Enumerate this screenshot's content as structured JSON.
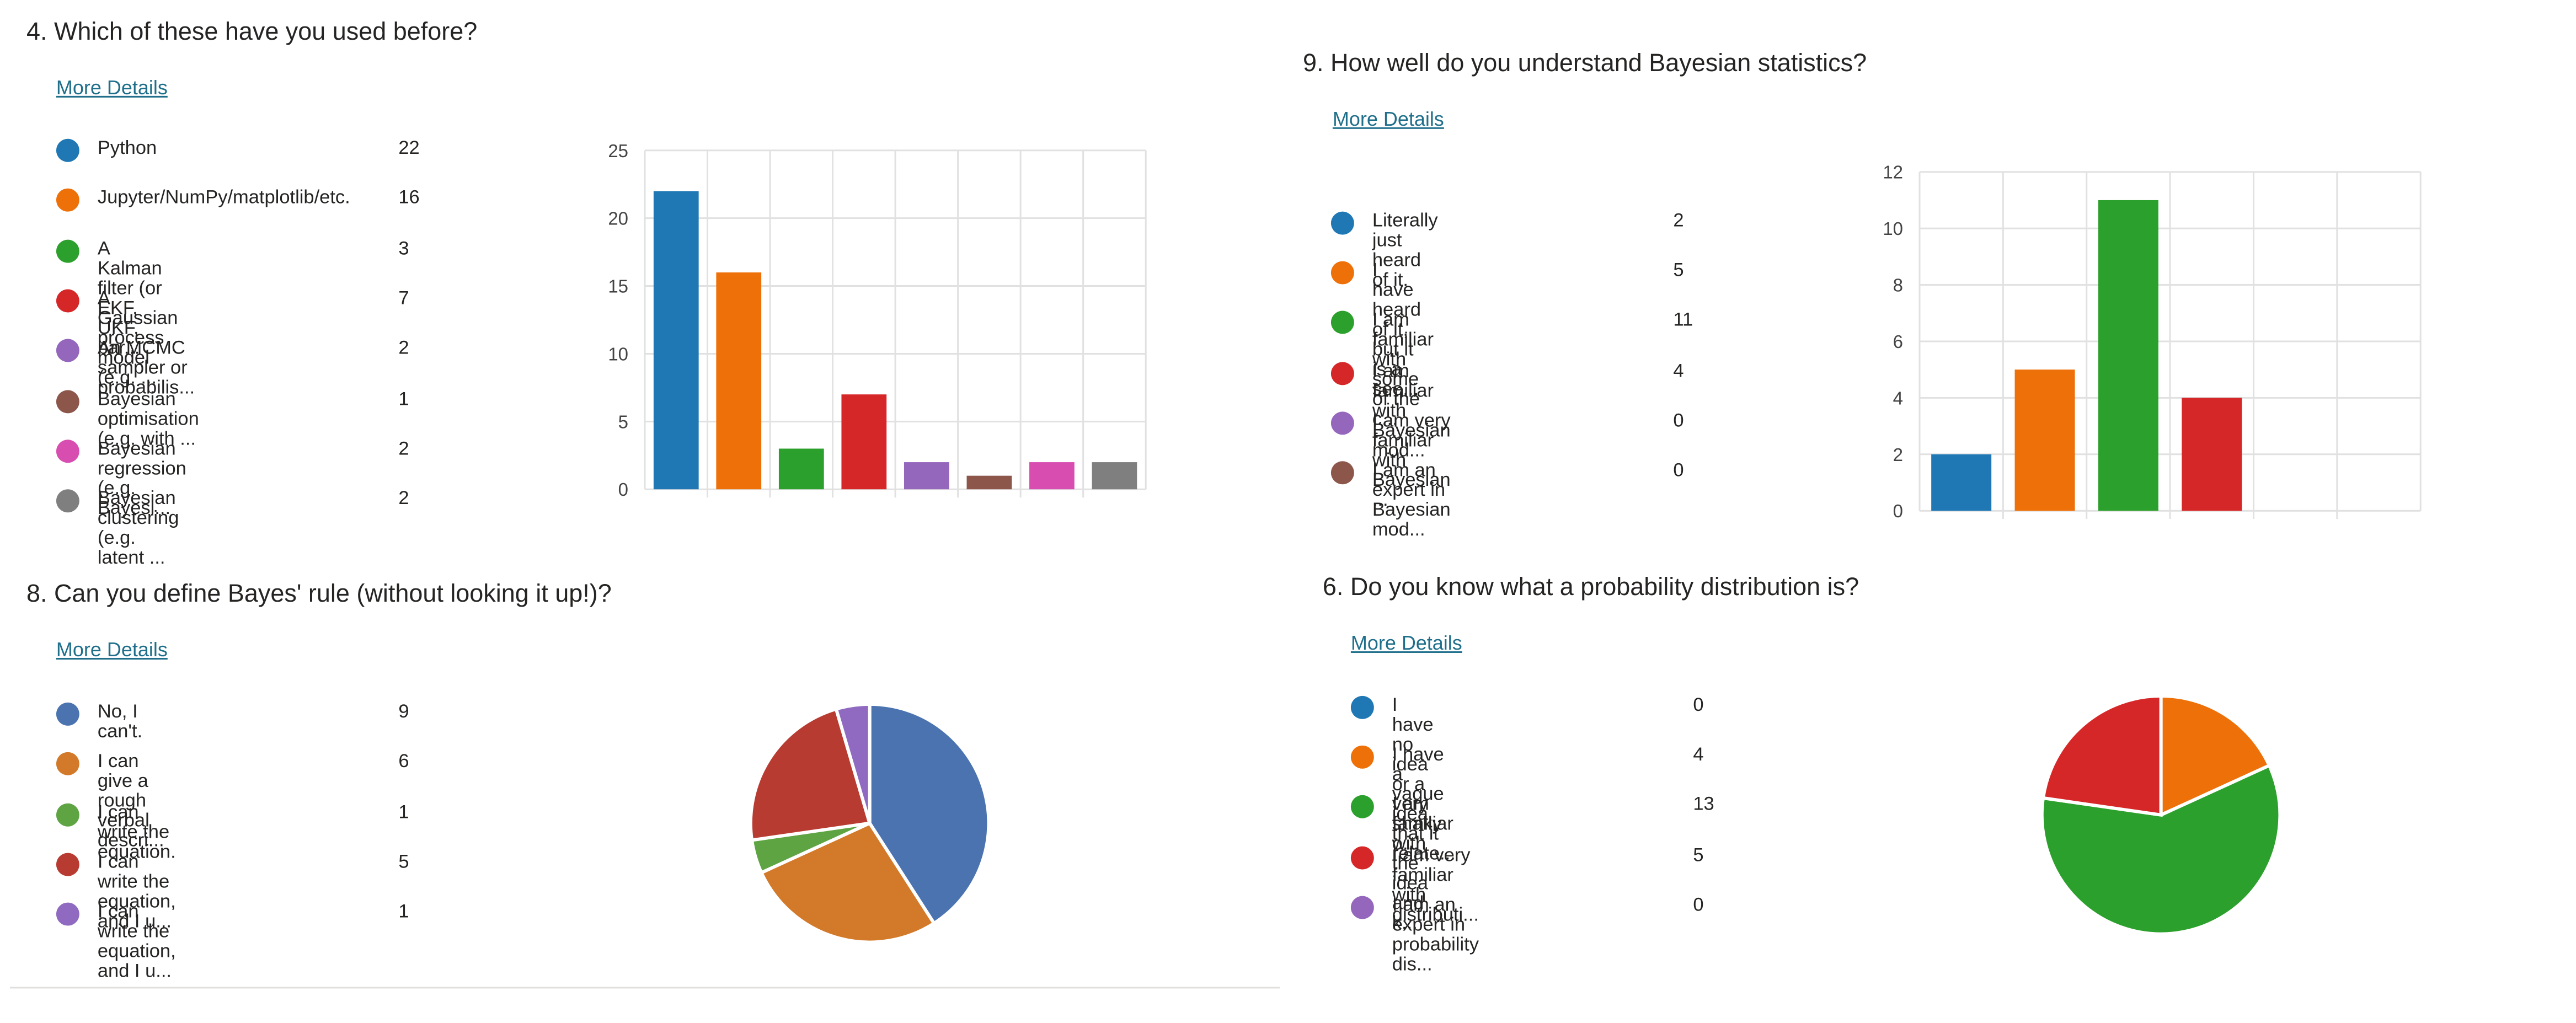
{
  "q4": {
    "title": "4.  Which of these have you used before?",
    "more_details": "More Details",
    "legend": [
      {
        "label": "Python",
        "count": "22",
        "color": "#1f77b4"
      },
      {
        "label": "Jupyter/NumPy/matplotlib/etc.",
        "count": "16",
        "color": "#ee7009"
      },
      {
        "label": "A Kalman filter (or EKF, UKF, par...",
        "count": "3",
        "color": "#2ca02c"
      },
      {
        "label": "A Gaussian process model (e.g. ...",
        "count": "7",
        "color": "#d62728"
      },
      {
        "label": "An MCMC sampler or probabilis...",
        "count": "2",
        "color": "#9467bd"
      },
      {
        "label": "Bayesian optimisation (e.g. with ...",
        "count": "1",
        "color": "#8c564b"
      },
      {
        "label": "Bayesian regression (e.g. Bayesi...",
        "count": "2",
        "color": "#d84eb0"
      },
      {
        "label": "Bayesian clustering (e.g. latent ...",
        "count": "2",
        "color": "#7f7f7f"
      }
    ]
  },
  "q9": {
    "title": "9.  How well do you understand Bayesian statistics?",
    "more_details": "More Details",
    "legend": [
      {
        "label": "Literally just heard of it.",
        "count": "2",
        "color": "#1f77b4"
      },
      {
        "label": "I have heard of it, but it is a see...",
        "count": "5",
        "color": "#ee7009"
      },
      {
        "label": "I am familiar with some of the c...",
        "count": "11",
        "color": "#2ca02c"
      },
      {
        "label": "I am familiar with Bayesian mod...",
        "count": "4",
        "color": "#d62728"
      },
      {
        "label": "I am very familiar with Bayesian ...",
        "count": "0",
        "color": "#9467bd"
      },
      {
        "label": "I am an expert in Bayesian mod...",
        "count": "0",
        "color": "#8c564b"
      }
    ]
  },
  "q8": {
    "title": "8.  Can you define Bayes' rule (without looking it up!)?",
    "more_details": "More Details",
    "legend": [
      {
        "label": "No, I can't.",
        "count": "9",
        "color": "#4a73b0"
      },
      {
        "label": "I can give a rough verbal descri...",
        "count": "6",
        "color": "#d37a2a"
      },
      {
        "label": "I can write the equation.",
        "count": "1",
        "color": "#5ea443"
      },
      {
        "label": "I can write the equation, and I u...",
        "count": "5",
        "color": "#b83b32"
      },
      {
        "label": "I can write the equation, and I u...",
        "count": "1",
        "color": "#8f6ac0"
      }
    ]
  },
  "q6": {
    "title": "6.  Do you know what a probability distribution is?",
    "more_details": "More Details",
    "legend": [
      {
        "label": "I have no idea or a very shaky o...",
        "count": "0",
        "color": "#1f77b4"
      },
      {
        "label": "I have a vague idea that it relate...",
        "count": "4",
        "color": "#ee7009"
      },
      {
        "label": "I am familiar with the idea and k...",
        "count": "13",
        "color": "#2ca02c"
      },
      {
        "label": "I am very familiar with distributi...",
        "count": "5",
        "color": "#d62728"
      },
      {
        "label": "I am an expert in probability dis...",
        "count": "0",
        "color": "#9467bd"
      }
    ]
  },
  "chart_data": [
    {
      "id": "q4",
      "type": "bar",
      "categories": [
        "Python",
        "Jupyter/NumPy/matplotlib/etc.",
        "A Kalman filter (or EKF, UKF, par...",
        "A Gaussian process model (e.g. ...",
        "An MCMC sampler or probabilis...",
        "Bayesian optimisation (e.g. with ...",
        "Bayesian regression (e.g. Bayesi...",
        "Bayesian clustering (e.g. latent ..."
      ],
      "values": [
        22,
        16,
        3,
        7,
        2,
        1,
        2,
        2
      ],
      "colors": [
        "#1f77b4",
        "#ee7009",
        "#2ca02c",
        "#d62728",
        "#9467bd",
        "#8c564b",
        "#d84eb0",
        "#7f7f7f"
      ],
      "ylim": [
        0,
        25
      ],
      "yticks": [
        "0",
        "5",
        "10",
        "15",
        "20",
        "25"
      ],
      "grid": true
    },
    {
      "id": "q9",
      "type": "bar",
      "categories": [
        "Literally just heard of it.",
        "I have heard of it, but it is a see...",
        "I am familiar with some of the c...",
        "I am familiar with Bayesian mod...",
        "I am very familiar with Bayesian ...",
        "I am an expert in Bayesian mod..."
      ],
      "values": [
        2,
        5,
        11,
        4,
        0,
        0
      ],
      "colors": [
        "#1f77b4",
        "#ee7009",
        "#2ca02c",
        "#d62728",
        "#9467bd",
        "#8c564b"
      ],
      "ylim": [
        0,
        12
      ],
      "yticks": [
        "0",
        "2",
        "4",
        "6",
        "8",
        "10",
        "12"
      ],
      "grid": true
    },
    {
      "id": "q8",
      "type": "pie",
      "labels": [
        "No, I can't.",
        "I can give a rough verbal descri...",
        "I can write the equation.",
        "I can write the equation, and I u...",
        "I can write the equation, and I u..."
      ],
      "values": [
        9,
        6,
        1,
        5,
        1
      ],
      "colors": [
        "#4a73b0",
        "#d37a2a",
        "#5ea443",
        "#b83b32",
        "#8f6ac0"
      ]
    },
    {
      "id": "q6",
      "type": "pie",
      "labels": [
        "I have no idea or a very shaky o...",
        "I have a vague idea that it relate...",
        "I am familiar with the idea and k...",
        "I am very familiar with distributi...",
        "I am an expert in probability dis..."
      ],
      "values": [
        0,
        4,
        13,
        5,
        0
      ],
      "colors": [
        "#1f77b4",
        "#ee7009",
        "#2ca02c",
        "#d62728",
        "#9467bd"
      ]
    }
  ]
}
